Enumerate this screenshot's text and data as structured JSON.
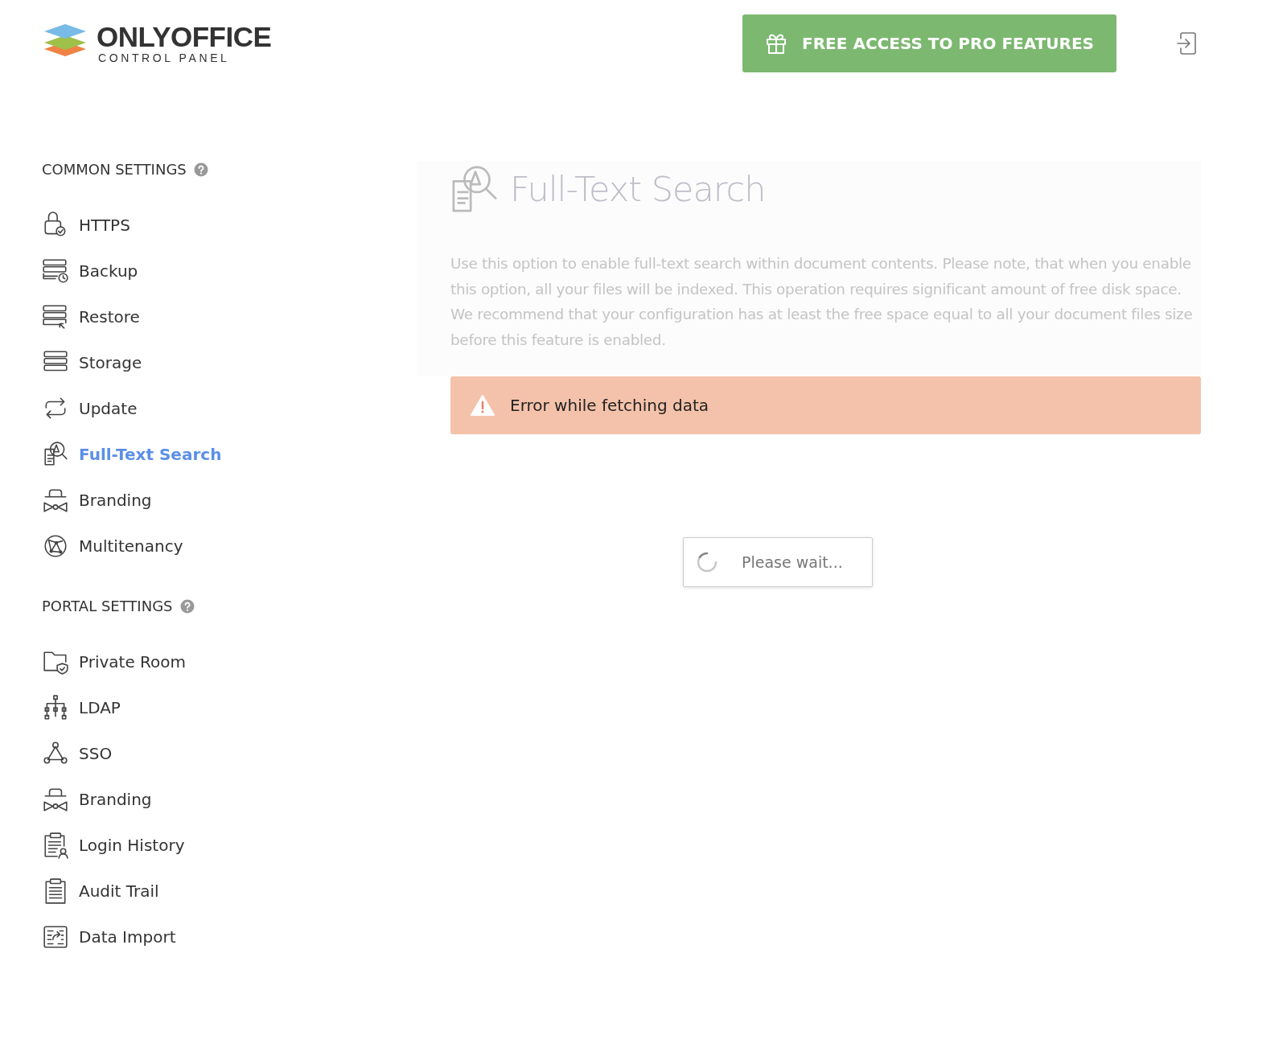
{
  "header": {
    "logo_name": "ONLYOFFICE",
    "logo_subtitle": "CONTROL PANEL",
    "promo_button": "FREE ACCESS TO PRO FEATURES"
  },
  "sidebar": {
    "sections": [
      {
        "title": "COMMON SETTINGS",
        "items": [
          {
            "label": "HTTPS",
            "selected": false
          },
          {
            "label": "Backup",
            "selected": false
          },
          {
            "label": "Restore",
            "selected": false
          },
          {
            "label": "Storage",
            "selected": false
          },
          {
            "label": "Update",
            "selected": false
          },
          {
            "label": "Full-Text Search",
            "selected": true
          },
          {
            "label": "Branding",
            "selected": false
          },
          {
            "label": "Multitenancy",
            "selected": false
          }
        ]
      },
      {
        "title": "PORTAL SETTINGS",
        "items": [
          {
            "label": "Private Room",
            "selected": false
          },
          {
            "label": "LDAP",
            "selected": false
          },
          {
            "label": "SSO",
            "selected": false
          },
          {
            "label": "Branding",
            "selected": false
          },
          {
            "label": "Login History",
            "selected": false
          },
          {
            "label": "Audit Trail",
            "selected": false
          },
          {
            "label": "Data Import",
            "selected": false
          }
        ]
      }
    ]
  },
  "content": {
    "title": "Full-Text Search",
    "description": "Use this option to enable full-text search within document contents. Please note, that when you enable this option, all your files will be indexed. This operation requires significant amount of free disk space. We recommend that your configuration has at least the free space equal to all your document files size before this feature is enabled.",
    "error": "Error while fetching data"
  },
  "loader": {
    "text": "Please wait..."
  }
}
